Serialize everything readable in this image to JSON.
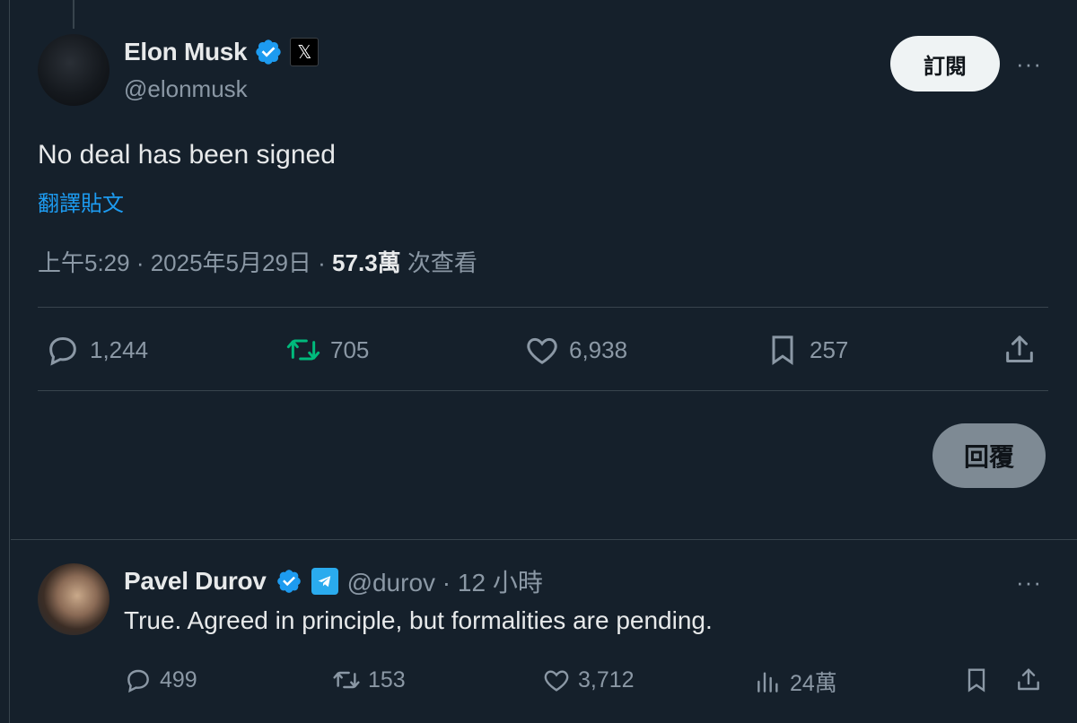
{
  "tweet": {
    "author_name": "Elon Musk",
    "author_handle": "@elonmusk",
    "affiliate_badge": "𝕏",
    "subscribe_label": "訂閱",
    "more": "···",
    "text": "No deal has been signed",
    "translate_label": "翻譯貼文",
    "time": "上午5:29 · 2025年5月29日 ·",
    "views": "57.3萬",
    "views_suffix": "次查看",
    "stats": {
      "replies": "1,244",
      "retweets": "705",
      "likes": "6,938",
      "bookmarks": "257"
    },
    "reply_button_label": "回覆"
  },
  "reply": {
    "author_name": "Pavel Durov",
    "author_handle": "@durov · 12 小時",
    "more": "···",
    "text": "True. Agreed in principle, but formalities are pending.",
    "stats": {
      "replies": "499",
      "retweets": "153",
      "likes": "3,712",
      "views": "24萬"
    }
  },
  "colors": {
    "background": "#15202b",
    "accent": "#1d9bf0",
    "muted": "#8b98a5",
    "retweet_green": "#00ba7c"
  }
}
